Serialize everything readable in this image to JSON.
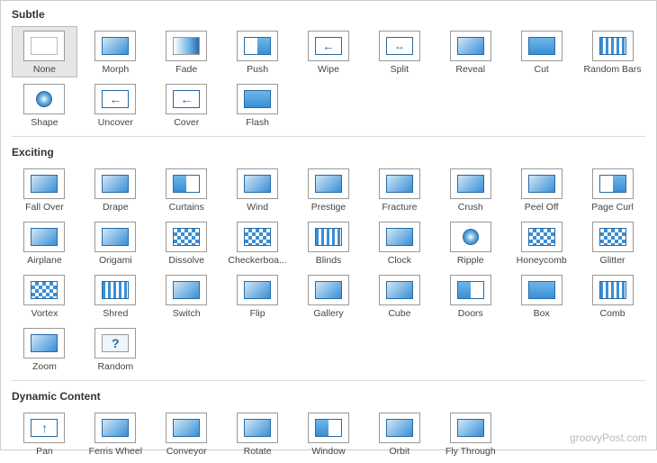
{
  "sections": [
    {
      "key": "subtle",
      "title": "Subtle",
      "items": [
        {
          "label": "None",
          "icon": "blank",
          "selected": true
        },
        {
          "label": "Morph",
          "icon": "generic"
        },
        {
          "label": "Fade",
          "icon": "fade"
        },
        {
          "label": "Push",
          "icon": "half-right"
        },
        {
          "label": "Wipe",
          "icon": "arrow-l"
        },
        {
          "label": "Split",
          "icon": "split"
        },
        {
          "label": "Reveal",
          "icon": "generic"
        },
        {
          "label": "Cut",
          "icon": "rect"
        },
        {
          "label": "Random Bars",
          "icon": "bars"
        },
        {
          "label": "Shape",
          "icon": "circle"
        },
        {
          "label": "Uncover",
          "icon": "arrow-l"
        },
        {
          "label": "Cover",
          "icon": "arrow-l"
        },
        {
          "label": "Flash",
          "icon": "rect"
        }
      ]
    },
    {
      "key": "exciting",
      "title": "Exciting",
      "items": [
        {
          "label": "Fall Over",
          "icon": "generic"
        },
        {
          "label": "Drape",
          "icon": "generic"
        },
        {
          "label": "Curtains",
          "icon": "half"
        },
        {
          "label": "Wind",
          "icon": "generic"
        },
        {
          "label": "Prestige",
          "icon": "generic"
        },
        {
          "label": "Fracture",
          "icon": "generic"
        },
        {
          "label": "Crush",
          "icon": "generic"
        },
        {
          "label": "Peel Off",
          "icon": "generic"
        },
        {
          "label": "Page Curl",
          "icon": "half-right"
        },
        {
          "label": "Airplane",
          "icon": "generic"
        },
        {
          "label": "Origami",
          "icon": "generic"
        },
        {
          "label": "Dissolve",
          "icon": "pattern"
        },
        {
          "label": "Checkerboa...",
          "icon": "pattern"
        },
        {
          "label": "Blinds",
          "icon": "bars"
        },
        {
          "label": "Clock",
          "icon": "generic"
        },
        {
          "label": "Ripple",
          "icon": "circle"
        },
        {
          "label": "Honeycomb",
          "icon": "pattern"
        },
        {
          "label": "Glitter",
          "icon": "pattern"
        },
        {
          "label": "Vortex",
          "icon": "pattern"
        },
        {
          "label": "Shred",
          "icon": "bars"
        },
        {
          "label": "Switch",
          "icon": "generic"
        },
        {
          "label": "Flip",
          "icon": "generic"
        },
        {
          "label": "Gallery",
          "icon": "generic"
        },
        {
          "label": "Cube",
          "icon": "generic"
        },
        {
          "label": "Doors",
          "icon": "half"
        },
        {
          "label": "Box",
          "icon": "rect"
        },
        {
          "label": "Comb",
          "icon": "bars"
        },
        {
          "label": "Zoom",
          "icon": "generic"
        },
        {
          "label": "Random",
          "icon": "question"
        }
      ]
    },
    {
      "key": "dynamic",
      "title": "Dynamic Content",
      "items": [
        {
          "label": "Pan",
          "icon": "arrow-up"
        },
        {
          "label": "Ferris Wheel",
          "icon": "generic"
        },
        {
          "label": "Conveyor",
          "icon": "generic"
        },
        {
          "label": "Rotate",
          "icon": "generic"
        },
        {
          "label": "Window",
          "icon": "half"
        },
        {
          "label": "Orbit",
          "icon": "generic"
        },
        {
          "label": "Fly Through",
          "icon": "generic"
        }
      ]
    }
  ],
  "watermark": "groovyPost.com"
}
